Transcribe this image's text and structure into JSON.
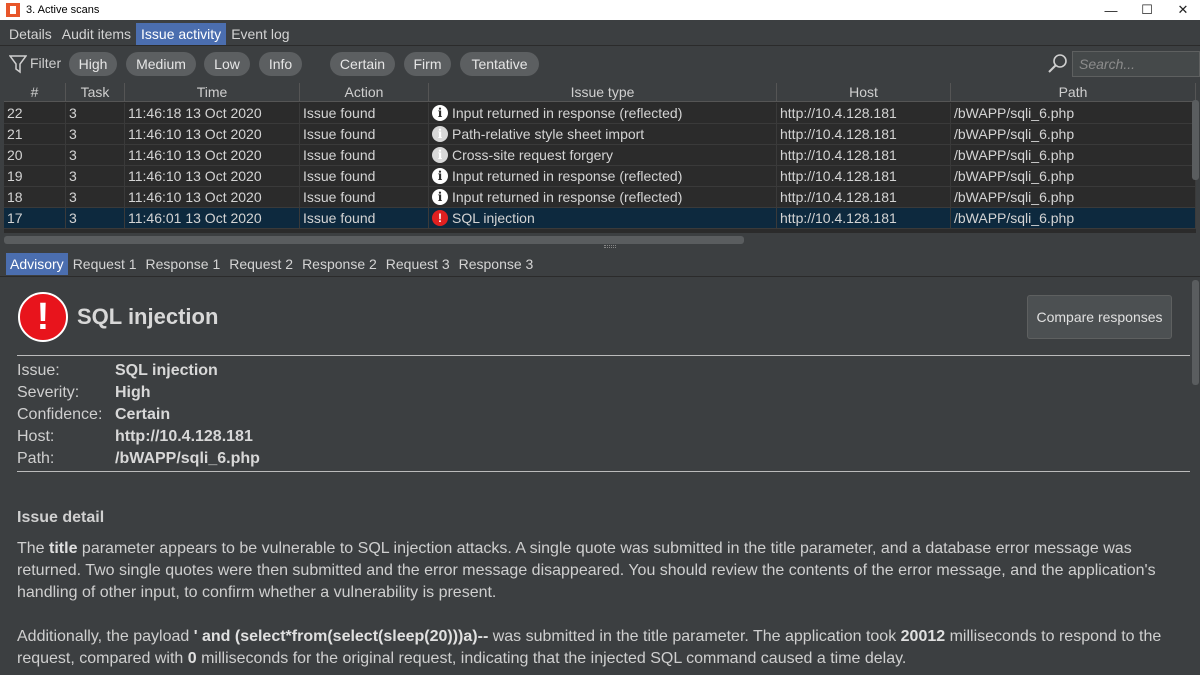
{
  "window": {
    "title": "3. Active scans",
    "minimize": "—",
    "maximize": "☐",
    "close": "✕"
  },
  "top_tabs": [
    "Details",
    "Audit items",
    "Issue activity",
    "Event log"
  ],
  "filter": {
    "label": "Filter",
    "severity": [
      "High",
      "Medium",
      "Low",
      "Info"
    ],
    "confidence": [
      "Certain",
      "Firm",
      "Tentative"
    ],
    "search_placeholder": "Search..."
  },
  "table": {
    "columns": [
      "#",
      "Task",
      "Time",
      "Action",
      "Issue type",
      "Host",
      "Path"
    ],
    "rows": [
      {
        "num": "22",
        "task": "3",
        "time": "11:46:18 13 Oct 2020",
        "action": "Issue found",
        "icon": "info-icon",
        "issue": "Input returned in response (reflected)",
        "host": "http://10.4.128.181",
        "path": "/bWAPP/sqli_6.php"
      },
      {
        "num": "21",
        "task": "3",
        "time": "11:46:10 13 Oct 2020",
        "action": "Issue found",
        "icon": "info-light-icon",
        "issue": "Path-relative style sheet import",
        "host": "http://10.4.128.181",
        "path": "/bWAPP/sqli_6.php"
      },
      {
        "num": "20",
        "task": "3",
        "time": "11:46:10 13 Oct 2020",
        "action": "Issue found",
        "icon": "info-light-icon",
        "issue": "Cross-site request forgery",
        "host": "http://10.4.128.181",
        "path": "/bWAPP/sqli_6.php"
      },
      {
        "num": "19",
        "task": "3",
        "time": "11:46:10 13 Oct 2020",
        "action": "Issue found",
        "icon": "info-icon",
        "issue": "Input returned in response (reflected)",
        "host": "http://10.4.128.181",
        "path": "/bWAPP/sqli_6.php"
      },
      {
        "num": "18",
        "task": "3",
        "time": "11:46:10 13 Oct 2020",
        "action": "Issue found",
        "icon": "info-icon",
        "issue": "Input returned in response (reflected)",
        "host": "http://10.4.128.181",
        "path": "/bWAPP/sqli_6.php"
      },
      {
        "num": "17",
        "task": "3",
        "time": "11:46:01 13 Oct 2020",
        "action": "Issue found",
        "icon": "alert-icon",
        "issue": "SQL injection",
        "host": "http://10.4.128.181",
        "path": "/bWAPP/sqli_6.php"
      }
    ]
  },
  "bottom_tabs": [
    "Advisory",
    "Request 1",
    "Response 1",
    "Request 2",
    "Response 2",
    "Request 3",
    "Response 3"
  ],
  "advisory": {
    "title": "SQL injection",
    "compare_button": "Compare responses",
    "fields": [
      {
        "key": "Issue:",
        "value": "SQL injection"
      },
      {
        "key": "Severity:",
        "value": "High"
      },
      {
        "key": "Confidence:",
        "value": "Certain"
      },
      {
        "key": "Host:",
        "value": "http://10.4.128.181"
      },
      {
        "key": "Path:",
        "value": "/bWAPP/sqli_6.php"
      }
    ],
    "section_heading": "Issue detail",
    "p1": {
      "t1": "The ",
      "b1": "title",
      "t2": " parameter appears to be vulnerable to SQL injection attacks. A single quote was submitted in the title parameter, and a database error message was returned. Two single quotes were then submitted and the error message disappeared. You should review the contents of the error message, and the application's handling of other input, to confirm whether a vulnerability is present."
    },
    "p2": {
      "t1": "Additionally, the payload ",
      "b1": "' and (select*from(select(sleep(20)))a)--",
      "t2": " was submitted in the title parameter. The application took ",
      "b2": "20012",
      "t3": " milliseconds to respond to the request, compared with ",
      "b3": "0",
      "t4": " milliseconds for the original request, indicating that the injected SQL command caused a time delay."
    }
  }
}
